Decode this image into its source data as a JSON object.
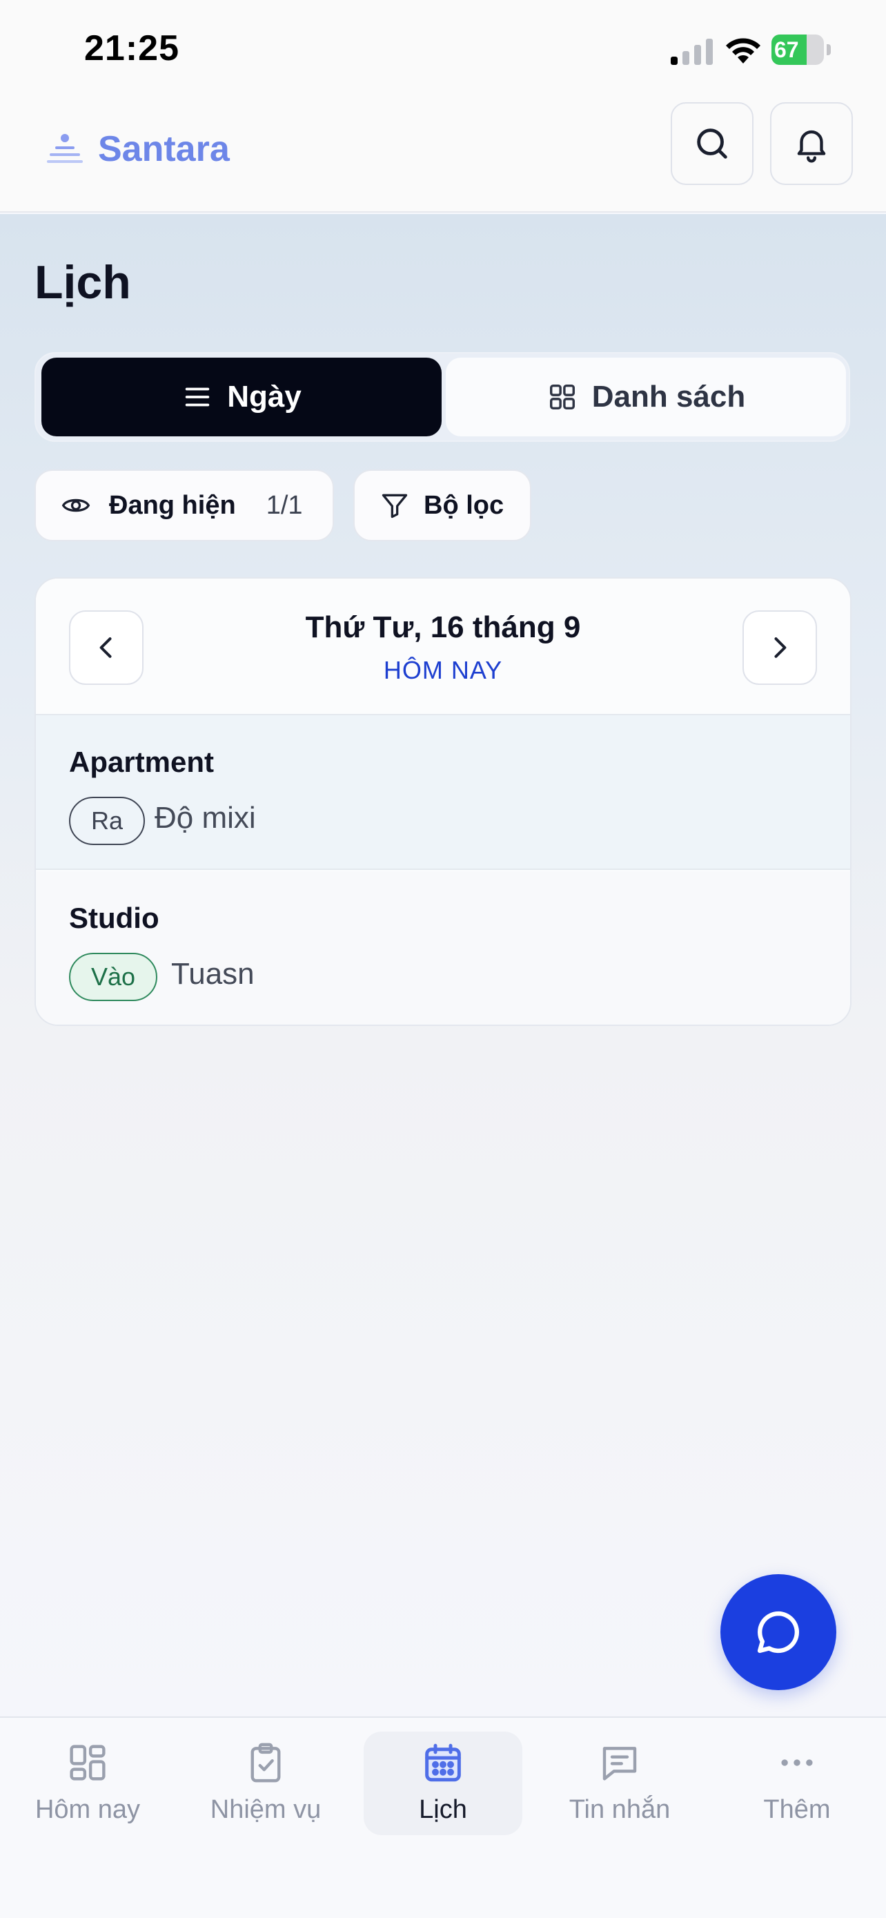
{
  "status_bar": {
    "time": "21:25",
    "battery_percent": "67",
    "battery_level": 0.67,
    "signal_icon": "cellular-signal-icon",
    "wifi_icon": "wifi-icon",
    "battery_icon": "battery-charging-icon"
  },
  "header": {
    "brand_name": "Santara",
    "brand_icon": "santara-logo-icon",
    "search_icon": "search-icon",
    "notifications_icon": "bell-icon"
  },
  "page": {
    "title": "Lịch",
    "view_toggle": {
      "day_label": "Ngày",
      "list_label": "Danh sách",
      "selected": "Ngày"
    },
    "showing_chip": {
      "label": "Đang hiện",
      "count": "1/1"
    },
    "filter_chip": {
      "label": "Bộ lọc"
    }
  },
  "calendar": {
    "date_title": "Thứ Tư, 16 tháng 9",
    "today_label": "HÔM NAY",
    "entries": [
      {
        "place": "Apartment",
        "direction": "Ra",
        "person": "Độ mixi"
      },
      {
        "place": "Studio",
        "direction": "Vào",
        "person": "Tuasn"
      }
    ]
  },
  "fab": {
    "icon": "chat-bubble-icon"
  },
  "bottom_nav": {
    "items": [
      {
        "label": "Hôm nay",
        "icon": "dashboard-grid-icon"
      },
      {
        "label": "Nhiệm vụ",
        "icon": "clipboard-check-icon"
      },
      {
        "label": "Lịch",
        "icon": "calendar-icon"
      },
      {
        "label": "Tin nhắn",
        "icon": "message-icon"
      },
      {
        "label": "Thêm",
        "icon": "more-dots-icon"
      }
    ],
    "active": "Lịch"
  },
  "colors": {
    "brand": "#6d86e8",
    "accent": "#1b3fe0",
    "active_segment": "#050816",
    "entry_in": "#2f8a5d",
    "entry_out": "#3e4453"
  }
}
